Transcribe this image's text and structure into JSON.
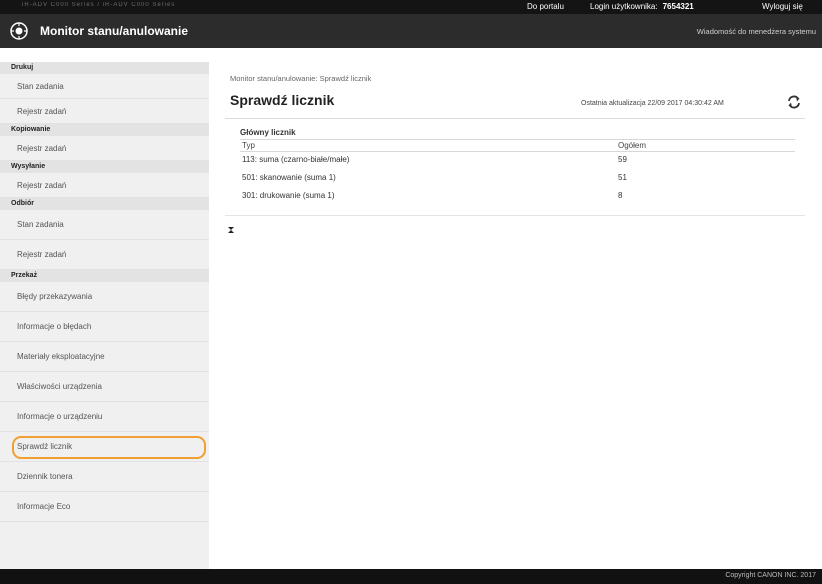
{
  "topbar": {
    "product": "iR-ADV C000 Series / iR-ADV C000 Series",
    "portal": "Do portalu",
    "login_label": "Login użytkownika:",
    "login_user": "7654321",
    "logout": "Wyloguj się"
  },
  "titlebar": {
    "title": "Monitor stanu/anulowanie",
    "message_link": "Wiadomość do menedżera systemu"
  },
  "sidebar": {
    "print_header": "Drukuj",
    "print_items": [
      "Stan zadania",
      "Rejestr zadań"
    ],
    "copy_header": "Kopiowanie",
    "copy_items": [
      "Rejestr zadań"
    ],
    "send_header": "Wysyłanie",
    "send_items": [
      "Rejestr zadań"
    ],
    "receive_header": "Odbiór",
    "receive_items": [
      "Stan zadania",
      "Rejestr zadań"
    ],
    "forward_header": "Przekaż",
    "forward_items": [
      "Błędy przekazywania",
      "Informacje o błędach",
      "Materiały eksploatacyjne",
      "Właściwości urządzenia",
      "Informacje o urządzeniu",
      "Sprawdź licznik",
      "Dziennik tonera",
      "Informacje Eco"
    ]
  },
  "main": {
    "breadcrumb": "Monitor stanu/anulowanie: Sprawdź licznik",
    "title": "Sprawdź licznik",
    "last_updated": "Ostatnia aktualizacja 22/09 2017 04:30:42 AM",
    "section_title": "Główny licznik",
    "col_type": "Typ",
    "col_total": "Ogółem",
    "rows": [
      {
        "type": "113: suma (czarno-białe/małe)",
        "total": "59"
      },
      {
        "type": "501: skanowanie (suma 1)",
        "total": "51"
      },
      {
        "type": "301: drukowanie (suma 1)",
        "total": "8"
      }
    ]
  },
  "footer": {
    "copyright": "Copyright CANON INC. 2017"
  },
  "colors": {
    "topbar": "#141414",
    "titlebar": "#2c2c2c",
    "sidebar_bg": "#f0f0f0",
    "highlight": "#f0a032"
  }
}
